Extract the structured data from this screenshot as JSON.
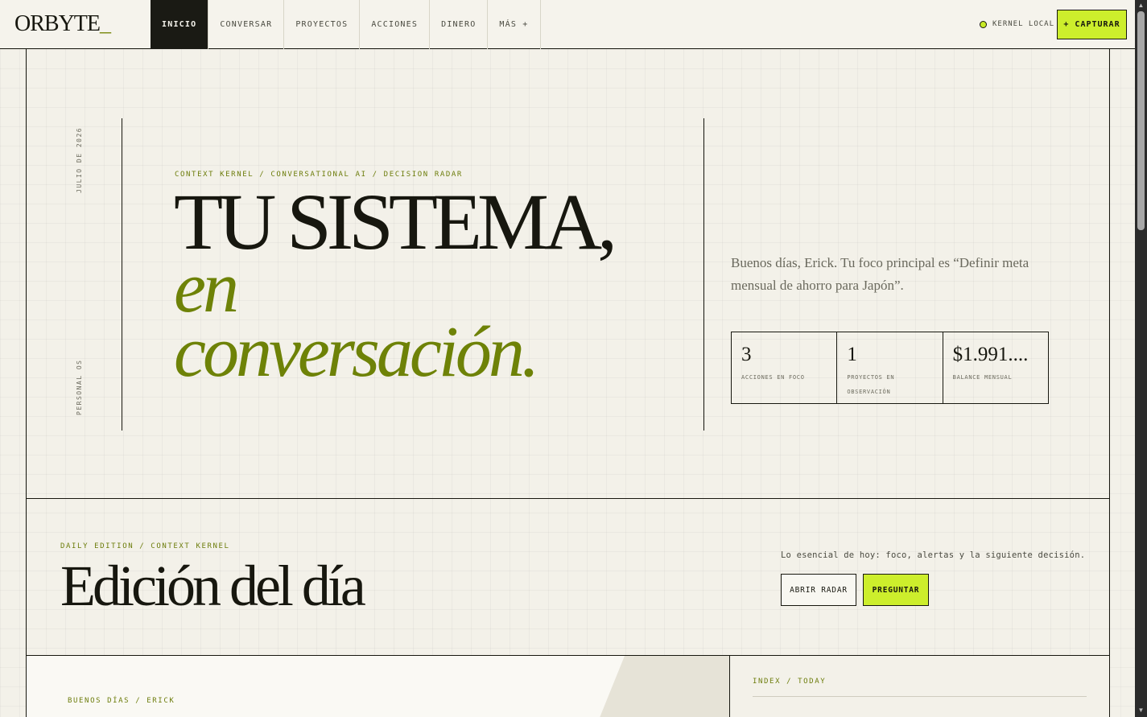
{
  "brand": {
    "name": "ORBYTE",
    "suffix": "_"
  },
  "nav": {
    "items": [
      {
        "label": "INICIO",
        "active": true
      },
      {
        "label": "CONVERSAR",
        "active": false
      },
      {
        "label": "PROYECTOS",
        "active": false
      },
      {
        "label": "ACCIONES",
        "active": false
      },
      {
        "label": "DINERO",
        "active": false
      },
      {
        "label": "MÁS +",
        "active": false
      }
    ]
  },
  "header": {
    "kernel_status": "KERNEL LOCAL",
    "capture_label": "+ CAPTURAR"
  },
  "hero": {
    "date_vertical": "JULIO DE 2026",
    "os_vertical": "PERSONAL OS",
    "kicker": "CONTEXT KERNEL / CONVERSATIONAL AI / DECISION RADAR",
    "title_line1": "TU SISTEMA,",
    "title_line2": "en",
    "title_line3": "conversación.",
    "greeting": "Buenos días, Erick. Tu foco principal es “Definir meta mensual de ahorro para Japón”.",
    "stats": [
      {
        "value": "3",
        "label": "ACCIONES EN FOCO"
      },
      {
        "value": "1",
        "label": "PROYECTOS EN OBSERVACIÓN"
      },
      {
        "value": "$1.991....",
        "label": "BALANCE MENSUAL"
      }
    ]
  },
  "edition": {
    "kicker": "DAILY EDITION / CONTEXT KERNEL",
    "title": "Edición del día",
    "summary": "Lo esencial de hoy: foco, alertas y la siguiente decisión.",
    "open_radar_label": "ABRIR RADAR",
    "ask_label": "PREGUNTAR"
  },
  "lower": {
    "left_kicker": "BUENOS DÍAS / ERICK",
    "right_kicker": "INDEX / TODAY"
  },
  "colors": {
    "accent": "#cdee2c",
    "olive": "#6e8207",
    "ink": "#17170f",
    "paper": "#f3f1e9"
  }
}
